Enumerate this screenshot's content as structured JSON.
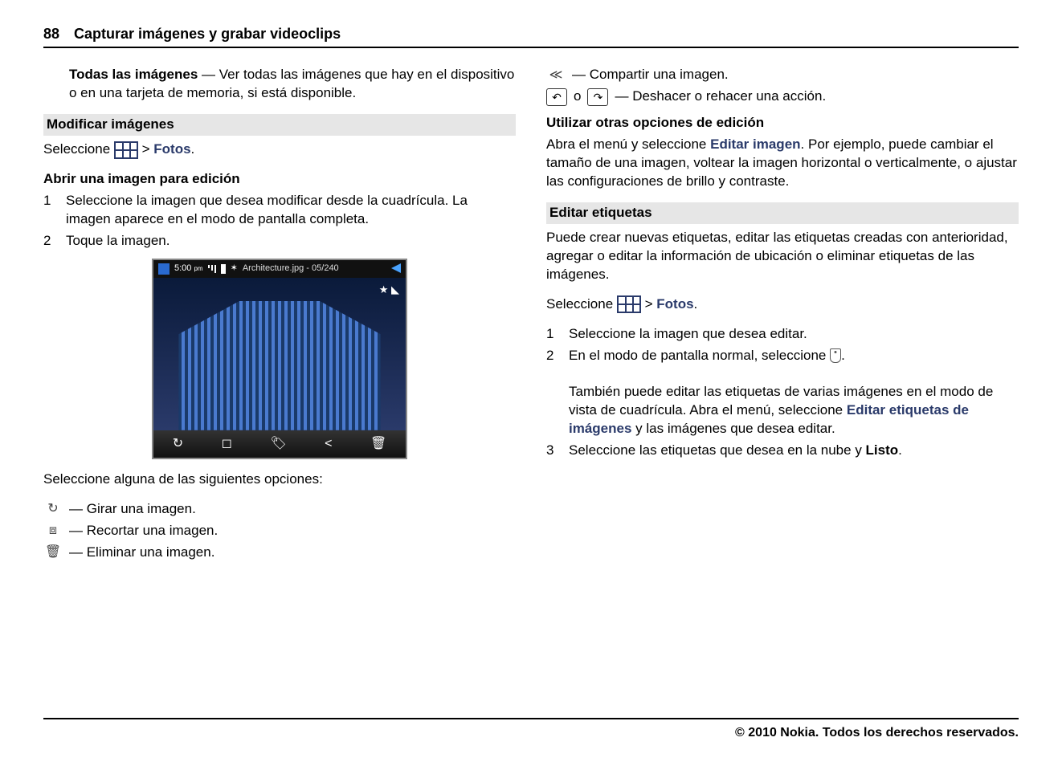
{
  "header": {
    "page_number": "88",
    "title": "Capturar imágenes y grabar videoclips"
  },
  "left": {
    "all_images": {
      "term": "Todas las imágenes",
      "sep": " — ",
      "desc": "Ver todas las imágenes que hay en el dispositivo o en una tarjeta de memoria, si está disponible."
    },
    "modify_heading": "Modificar imágenes",
    "select_line": {
      "pre": "Seleccione ",
      "post": " > ",
      "menu": "Fotos",
      "end": "."
    },
    "open_edit_heading": "Abrir una imagen para edición",
    "steps": [
      {
        "n": "1",
        "t": "Seleccione la imagen que desea modificar desde la cuadrícula. La imagen aparece en el modo de pantalla completa."
      },
      {
        "n": "2",
        "t": "Toque la imagen."
      }
    ],
    "phone": {
      "time": "5:00",
      "ampm": "pm",
      "filename": "Architecture.jpg - 05/240",
      "star": "★ ◣"
    },
    "options_intro": "Seleccione alguna de las siguientes opciones:",
    "options": [
      {
        "icon": "rotate",
        "text": " — Girar una imagen."
      },
      {
        "icon": "crop",
        "text": " — Recortar una imagen."
      },
      {
        "icon": "trash",
        "text": " — Eliminar una imagen."
      }
    ]
  },
  "right": {
    "options_cont": [
      {
        "icon": "share",
        "text": " — Compartir una imagen."
      }
    ],
    "undo_redo": {
      "mid": " o ",
      "text": " — Deshacer o rehacer una acción."
    },
    "other_heading": "Utilizar otras opciones de edición",
    "other_text_pre": "Abra el menú y seleccione ",
    "other_menu": "Editar imagen",
    "other_text_post": ". Por ejemplo, puede cambiar el tamaño de una imagen, voltear la imagen horizontal o verticalmente, o ajustar las configuraciones de brillo y contraste.",
    "tags_heading": "Editar etiquetas",
    "tags_intro": "Puede crear nuevas etiquetas, editar las etiquetas creadas con anterioridad, agregar o editar la información de ubicación o eliminar etiquetas de las imágenes.",
    "select_line": {
      "pre": "Seleccione ",
      "post": " > ",
      "menu": "Fotos",
      "end": "."
    },
    "tag_steps": [
      {
        "n": "1",
        "t": "Seleccione la imagen que desea editar."
      },
      {
        "n": "2",
        "t_pre": "En el modo de pantalla normal, seleccione ",
        "t_post": ".",
        "extra_pre": "También puede editar las etiquetas de varias imágenes en el modo de vista de cuadrícula. Abra el menú, seleccione ",
        "extra_menu": "Editar etiquetas de imágenes",
        "extra_post": " y las imágenes que desea editar."
      },
      {
        "n": "3",
        "t_pre": "Seleccione las etiquetas que desea en la nube y ",
        "t_bold": "Listo",
        "t_post": "."
      }
    ]
  },
  "footer": "© 2010 Nokia. Todos los derechos reservados."
}
